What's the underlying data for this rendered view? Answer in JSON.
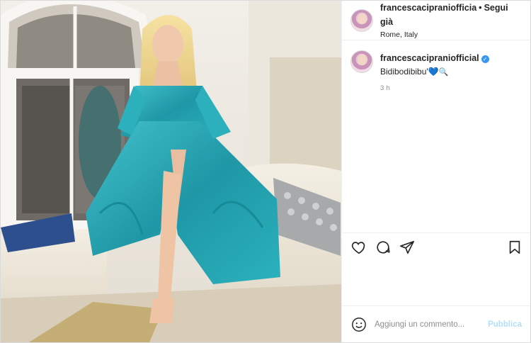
{
  "header": {
    "username": "francescacipraniofficia",
    "separator": "•",
    "follow_label": "Segui già",
    "location": "Rome, Italy"
  },
  "caption": {
    "username": "francescacipraniofficial",
    "verified_mark": "✓",
    "text": "Bidibodibibu'",
    "emoji_heart": "💙",
    "emoji_mag": "🔍",
    "time": "3 h"
  },
  "actions": {
    "like_icon": "heart-outline-icon",
    "comment_icon": "speech-bubble-icon",
    "share_icon": "paper-plane-icon",
    "save_icon": "bookmark-icon"
  },
  "comment_box": {
    "placeholder": "Aggiungi un commento...",
    "publish_label": "Pubblica"
  },
  "colors": {
    "dress": "#2ba7b4",
    "verified": "#3897f0",
    "publish_disabled": "#b2dffc"
  }
}
